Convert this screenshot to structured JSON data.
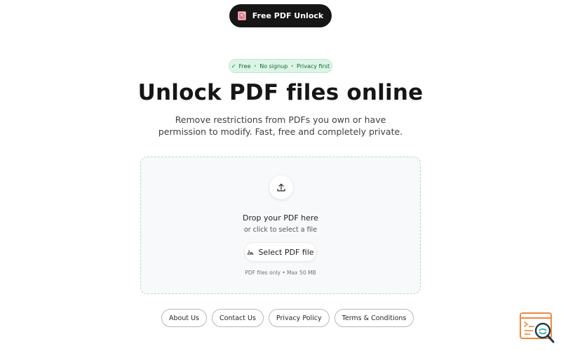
{
  "header": {
    "brand_label": "Free PDF Unlock",
    "brand_icon": "pdf-file-icon"
  },
  "badge": {
    "items": [
      "Free",
      "No signup",
      "Privacy first"
    ],
    "check_icon": "check-icon",
    "separator": "•"
  },
  "hero": {
    "title": "Unlock PDF files online",
    "subtitle": "Remove restrictions from PDFs you own or have permission to modify. Fast, free and completely private."
  },
  "dropzone": {
    "upload_icon": "upload-icon",
    "title": "Drop your PDF here",
    "subtitle": "or click to select a file",
    "button_label": "Select PDF file",
    "button_icon": "image-file-icon",
    "note": "PDF files only • Max 50 MB"
  },
  "footer": {
    "links": [
      "About Us",
      "Contact Us",
      "Privacy Policy",
      "Terms & Conditions"
    ]
  },
  "widget": {
    "icon": "search-code-icon"
  },
  "colors": {
    "brand_pill_bg": "#161616",
    "badge_bg": "#dcf5e6",
    "badge_text": "#166534",
    "dropzone_border": "#b9d9c8",
    "widget_accent": "#f0883e"
  }
}
